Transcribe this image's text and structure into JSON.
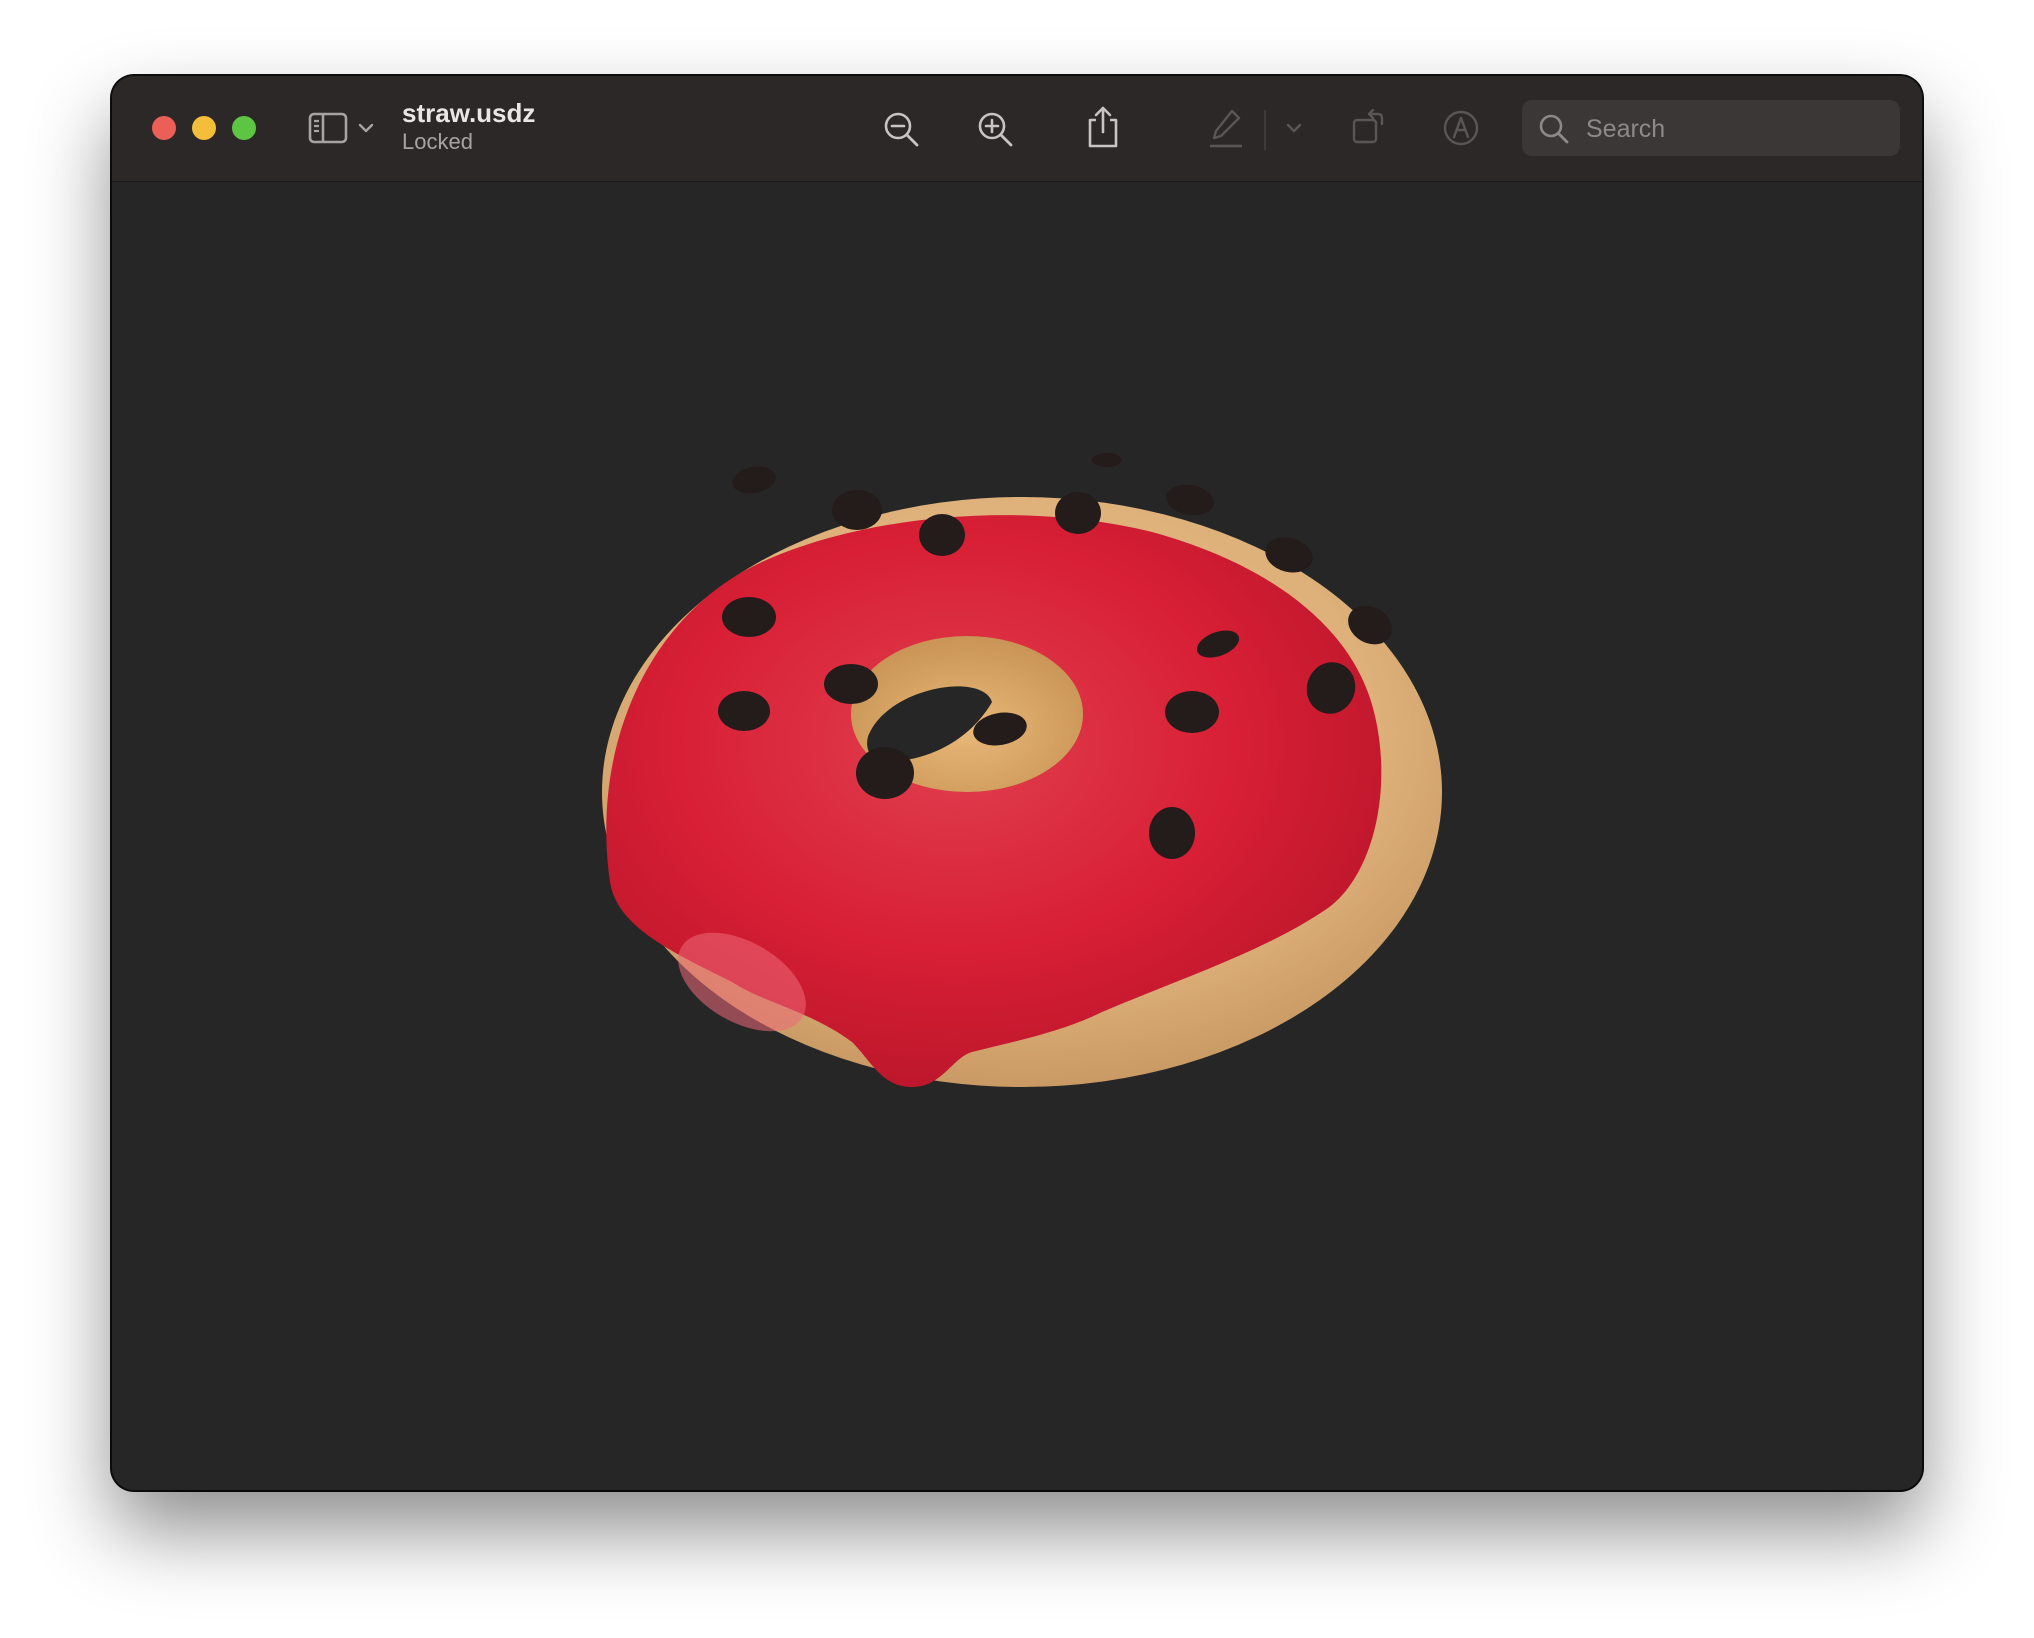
{
  "window": {
    "title": "straw.usdz",
    "subtitle": "Locked"
  },
  "traffic_lights": {
    "close_color": "#ec5f57",
    "minimize_color": "#f4bd3a",
    "maximize_color": "#5ec443"
  },
  "toolbar": {
    "icons": [
      "sidebar-icon",
      "chevron-down-icon",
      "zoom-out-icon",
      "zoom-in-icon",
      "share-icon",
      "markup-pen-icon",
      "chevron-down-icon",
      "rotate-icon",
      "annotate-icon"
    ]
  },
  "search": {
    "placeholder": "Search",
    "value": ""
  },
  "model": {
    "icing_color": "#d81f35",
    "dough_color": "#e0b27c",
    "sprinkle_color": "#241b1b"
  }
}
